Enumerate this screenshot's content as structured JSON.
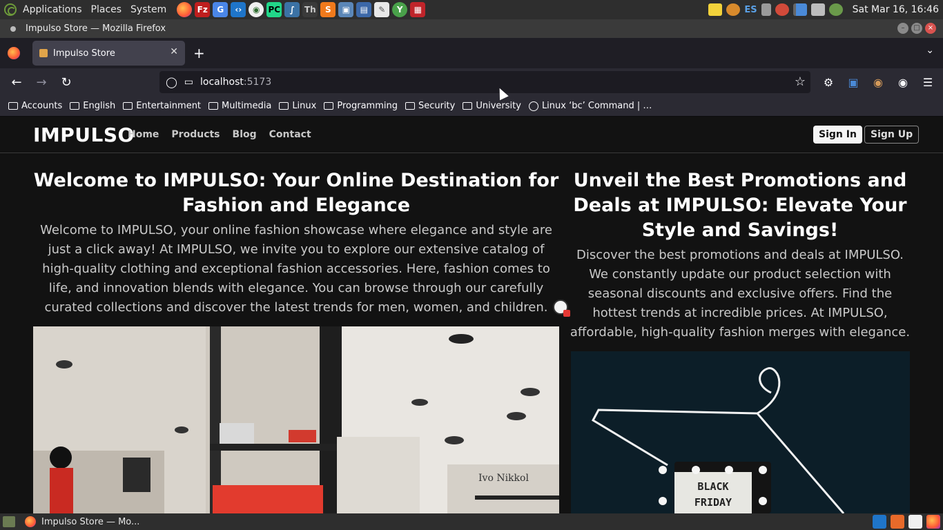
{
  "os_panel": {
    "menus": [
      "Applications",
      "Places",
      "System"
    ],
    "launchers": [
      "firefox-icon",
      "filezilla-icon",
      "google-translate-icon",
      "vscode-icon",
      "mongodb-compass-icon",
      "pycharm-icon",
      "python-icon",
      "typora-icon",
      "sublime-text-icon",
      "virtualbox-icon",
      "network-icon",
      "text-editor-icon",
      "app-icon",
      "terminal-red-icon"
    ],
    "tray": {
      "language": "ES",
      "clock": "Sat Mar 16, 16:46"
    }
  },
  "window": {
    "title": "Impulso Store — Mozilla Firefox"
  },
  "browser": {
    "tab_title": "Impulso Store",
    "url_host": "localhost",
    "url_port": ":5173",
    "bookmarks": [
      {
        "label": "Accounts",
        "type": "folder"
      },
      {
        "label": "English",
        "type": "folder"
      },
      {
        "label": "Entertainment",
        "type": "folder"
      },
      {
        "label": "Multimedia",
        "type": "folder"
      },
      {
        "label": "Linux",
        "type": "folder"
      },
      {
        "label": "Programming",
        "type": "folder"
      },
      {
        "label": "Security",
        "type": "folder"
      },
      {
        "label": "University",
        "type": "folder"
      },
      {
        "label": "Linux ‘bc’ Command | …",
        "type": "link"
      }
    ]
  },
  "site": {
    "brand": "IMPULSO",
    "nav": [
      "Home",
      "Products",
      "Blog",
      "Contact"
    ],
    "sign_in": "Sign In",
    "sign_up": "Sign Up",
    "left": {
      "heading": "Welcome to IMPULSO: Your Online Destination for Fashion and Elegance",
      "body": "Welcome to IMPULSO, your online fashion showcase where elegance and style are just a click away! At IMPULSO, we invite you to explore our extensive catalog of high-quality clothing and exceptional fashion accessories. Here, fashion comes to life, and innovation blends with elegance. You can browse through our carefully curated collections and discover the latest trends for men, women, and children.",
      "image_sign": "Ivo Nikkol"
    },
    "right": {
      "heading": "Unveil the Best Promotions and Deals at IMPULSO: Elevate Your Style and Savings!",
      "body": "Discover the best promotions and deals at IMPULSO. We constantly update our product selection with seasonal discounts and exclusive offers. Find the hottest trends at incredible prices. At IMPULSO, affordable, high-quality fashion merges with elegance.",
      "image_text_1": "BLACK",
      "image_text_2": "FRIDAY"
    }
  },
  "taskbar": {
    "task_label": "Impulso Store — Mo..."
  }
}
